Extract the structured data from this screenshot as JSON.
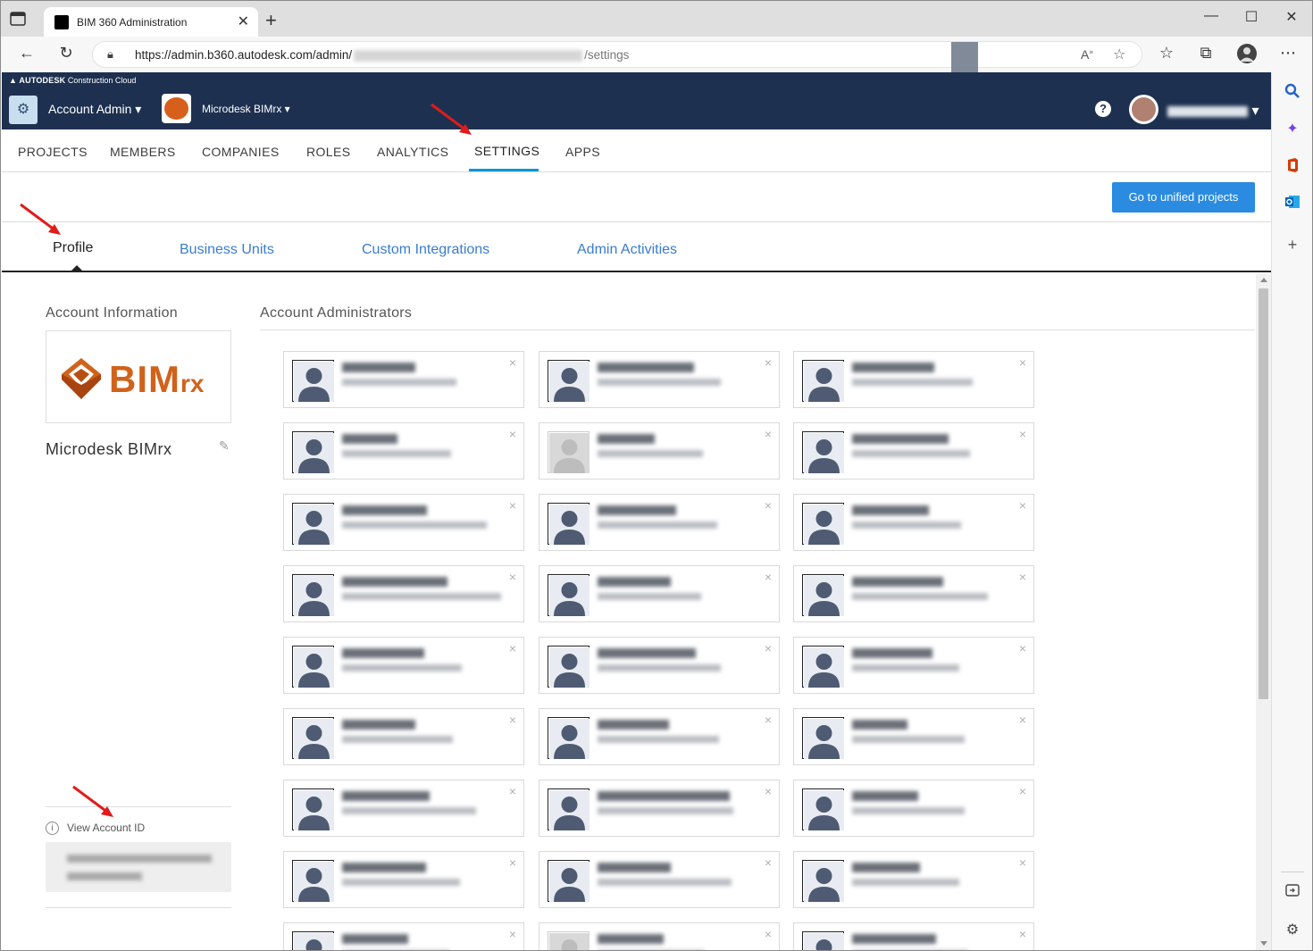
{
  "browser": {
    "tab_title": "BIM 360 Administration",
    "tab_close": "✕",
    "new_tab": "+",
    "window_controls": {
      "minimize": "—",
      "maximize": "☐",
      "close": "✕"
    },
    "url_prefix": "https://admin.b360.autodesk.com/admin/",
    "url_suffix": "/settings",
    "toolbar_icons": [
      "back-icon",
      "refresh-icon",
      "read-aloud-icon",
      "favorites-add-icon",
      "favorites-icon",
      "collections-icon",
      "profile-icon",
      "more-icon"
    ],
    "sidebar_icons": [
      "search-icon",
      "copilot-icon",
      "office-icon",
      "outlook-icon",
      "add-icon",
      "split-screen-icon",
      "settings-icon"
    ]
  },
  "app": {
    "brand_bold": "AUTODESK",
    "brand_rest": "Construction Cloud",
    "module": "Account Admin",
    "account": "Microdesk BIMrx",
    "help": "?",
    "nav": [
      "PROJECTS",
      "MEMBERS",
      "COMPANIES",
      "ROLES",
      "ANALYTICS",
      "SETTINGS",
      "APPS"
    ],
    "nav_active": "SETTINGS",
    "unified_button": "Go to unified projects",
    "subtabs": [
      "Profile",
      "Business Units",
      "Custom Integrations",
      "Admin Activities"
    ],
    "subtab_active": "Profile"
  },
  "profile": {
    "account_info_heading": "Account Information",
    "logo_text": "BIM",
    "logo_suffix": "rx",
    "company_name": "Microdesk BIMrx",
    "view_account_id": "View Account ID",
    "info_glyph": "i",
    "admins_heading": "Account Administrators",
    "card_close": "×"
  },
  "colors": {
    "topnav": "#1e3050",
    "accent": "#0696d7",
    "button": "#2a8be0",
    "link": "#3a7ccf",
    "logo_orange": "#d0621a",
    "annotation_arrow": "#e11b1b"
  }
}
